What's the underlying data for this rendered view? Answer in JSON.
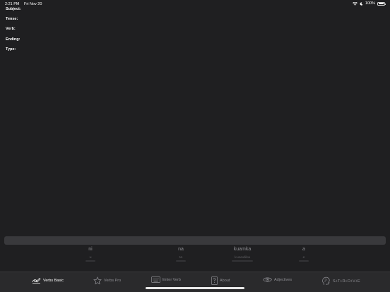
{
  "status_bar": {
    "time": "2:21 PM",
    "date": "Fri Nov 20",
    "battery_percent": "100%",
    "battery_level": 1.0
  },
  "fields": [
    {
      "label": "Subject:"
    },
    {
      "label": "Tense:"
    },
    {
      "label": "Verb:"
    },
    {
      "label": "Ending:"
    },
    {
      "label": "Type:"
    }
  ],
  "picker": {
    "columns": [
      {
        "selected": "ni",
        "next": "u"
      },
      {
        "selected": "na",
        "next": "ta"
      },
      {
        "selected": "kuamka",
        "next": "kuandika"
      },
      {
        "selected": "a",
        "next": "e"
      }
    ]
  },
  "tabs": [
    {
      "label": "Verbs Basic",
      "icon": "verbs-basic-icon",
      "active": true
    },
    {
      "label": "Verbs Pro",
      "icon": "star-icon",
      "active": false
    },
    {
      "label": "Enter Verb",
      "icon": "keyboard-icon",
      "active": false
    },
    {
      "label": "About",
      "icon": "question-icon",
      "active": false
    },
    {
      "label": "Adjectives",
      "icon": "eye-icon",
      "active": false
    },
    {
      "label": "S+T+R+O+V+E",
      "icon": "brain-icon",
      "active": false
    }
  ],
  "colors": {
    "background": "#1f1f21",
    "tab_bar": "#2a2a2c",
    "active": "#ffffff",
    "inactive": "#8e8e93"
  }
}
